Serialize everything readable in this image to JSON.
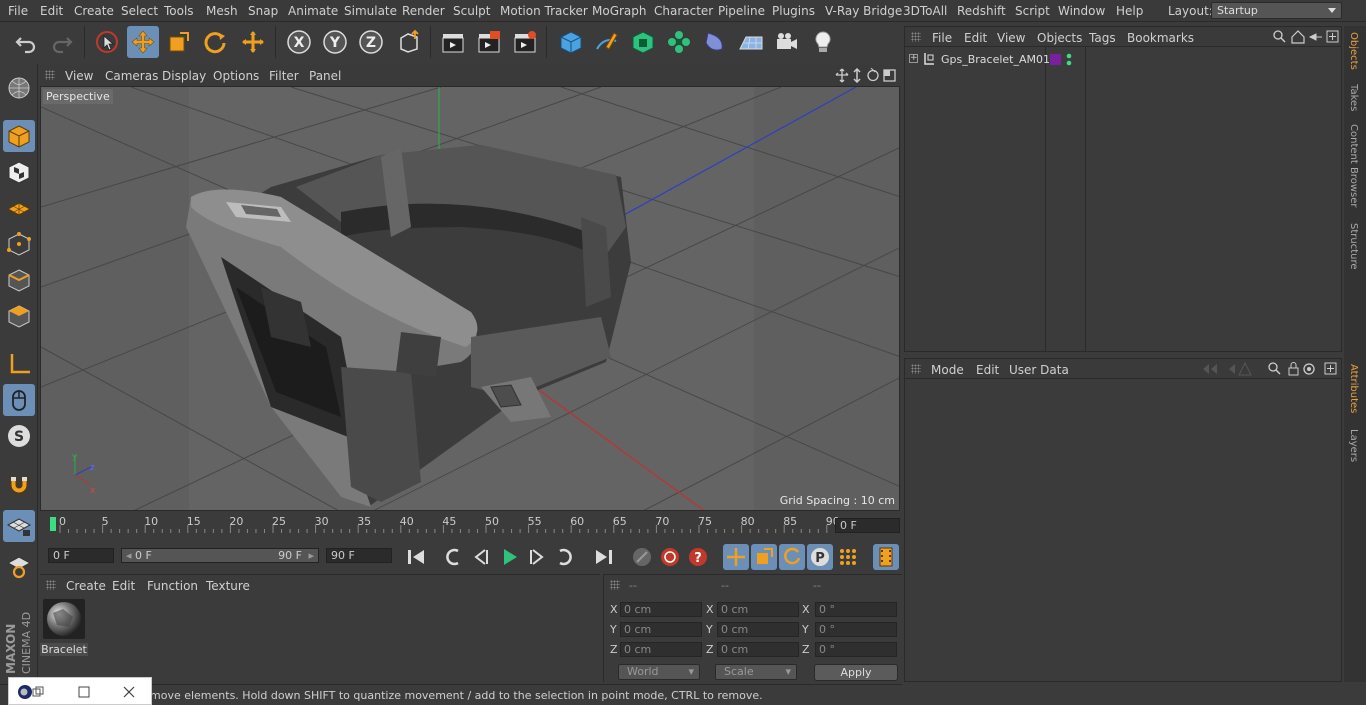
{
  "menubar": {
    "items": [
      "File",
      "Edit",
      "Create",
      "Select",
      "Tools",
      "Mesh",
      "Snap",
      "Animate",
      "Simulate",
      "Render",
      "Sculpt",
      "Motion Tracker",
      "MoGraph",
      "Character",
      "Pipeline",
      "Plugins",
      "V-Ray Bridge",
      "3DToAll",
      "Redshift",
      "Script",
      "Window",
      "Help"
    ],
    "layout_label": "Layout:",
    "layout_value": "Startup"
  },
  "viewport": {
    "menu": [
      "View",
      "Cameras",
      "Display",
      "Options",
      "Filter",
      "Panel"
    ],
    "camera_label": "Perspective",
    "grid_spacing": "Grid Spacing : 10 cm"
  },
  "timeline": {
    "ticks": [
      "0",
      "5",
      "10",
      "15",
      "20",
      "25",
      "30",
      "35",
      "40",
      "45",
      "50",
      "55",
      "60",
      "65",
      "70",
      "75",
      "80",
      "85",
      "90"
    ],
    "current_frame": "0 F"
  },
  "transport": {
    "start_field": "0 F",
    "range_start": "0 F",
    "range_end": "90 F",
    "end_field": "90 F"
  },
  "materials": {
    "menu": [
      "Create",
      "Edit",
      "Function",
      "Texture"
    ],
    "items": [
      {
        "name": "Bracelet"
      }
    ]
  },
  "coords": {
    "headers": [
      "--",
      "--",
      "--"
    ],
    "rows": [
      {
        "axis": "X",
        "pos": "0 cm",
        "size": "0 cm",
        "rot": "0 °"
      },
      {
        "axis": "Y",
        "pos": "0 cm",
        "size": "0 cm",
        "rot": "0 °"
      },
      {
        "axis": "Z",
        "pos": "0 cm",
        "size": "0 cm",
        "rot": "0 °"
      }
    ],
    "mode_dropdown": "World",
    "scale_dropdown": "Scale",
    "apply_label": "Apply"
  },
  "objects": {
    "menu": [
      "File",
      "Edit",
      "View",
      "Objects",
      "Tags",
      "Bookmarks"
    ],
    "items": [
      {
        "name": "Gps_Bracelet_AM01",
        "color": "#7b1fa2"
      }
    ]
  },
  "attributes": {
    "menu": [
      "Mode",
      "Edit",
      "User Data"
    ]
  },
  "right_tabs": [
    "Objects",
    "Takes",
    "Content Browser",
    "Structure",
    "Attributes",
    "Layers"
  ],
  "status": {
    "text": "move elements. Hold down SHIFT to quantize movement / add to the selection in point mode, CTRL to remove."
  },
  "branding": {
    "maxon": "MAXON",
    "cinema": "CINEMA 4D"
  },
  "colors": {
    "accent_blue": "#6c8fb8",
    "timeline_marker": "#3ddc84",
    "axis_x": "#c23030",
    "axis_y": "#2fa84a",
    "axis_z": "#2f3fbf"
  }
}
